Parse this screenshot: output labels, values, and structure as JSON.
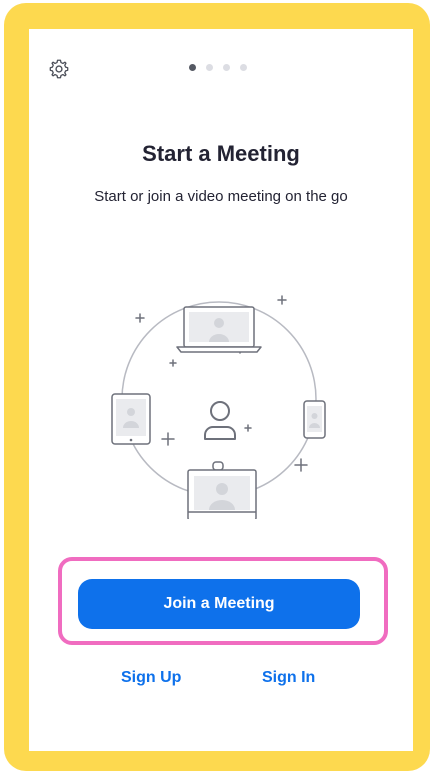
{
  "onboarding": {
    "title": "Start a Meeting",
    "subtitle": "Start or join a video meeting on the go",
    "pager": {
      "total": 4,
      "active": 1
    }
  },
  "actions": {
    "join_label": "Join a Meeting",
    "sign_up_label": "Sign Up",
    "sign_in_label": "Sign In"
  },
  "colors": {
    "accent": "#0e71eb",
    "frame": "#fdd94f",
    "highlight": "#f06cc0",
    "text": "#232333"
  },
  "icons": [
    "settings-gear-icon",
    "meeting-devices-illustration"
  ]
}
